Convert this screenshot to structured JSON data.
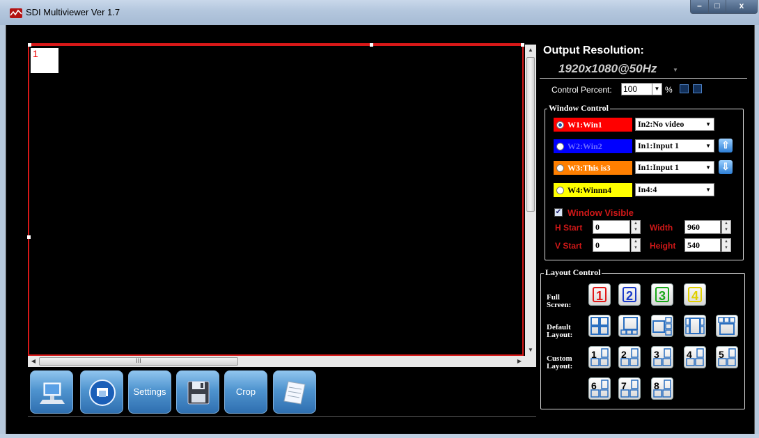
{
  "window": {
    "title": "SDI Multiviewer  Ver 1.7",
    "controls": {
      "minimize": "–",
      "maximize": "□",
      "close": "x"
    }
  },
  "preview": {
    "window_label": "1",
    "hscroll_grip": "III"
  },
  "toolbar": {
    "settings_label": "Settings",
    "crop_label": "Crop"
  },
  "output": {
    "title": "Output Resolution:",
    "resolution": "1920x1080@50Hz"
  },
  "control_percent": {
    "label": "Control Percent:",
    "value": "100",
    "unit": "%"
  },
  "window_control": {
    "legend": "Window Control",
    "windows": [
      {
        "name": "W1:Win1",
        "input": "In2:No video",
        "color": "#ff0000",
        "text_color": "#ffffff",
        "selected": true
      },
      {
        "name": "W2:Win2",
        "input": "In1:Input 1",
        "color": "#0000ff",
        "text_color": "#6a6aff",
        "selected": false
      },
      {
        "name": "W3:This is3",
        "input": "In1:Input 1",
        "color": "#ff7f00",
        "text_color": "#ffffff",
        "selected": false
      },
      {
        "name": "W4:Winnn4",
        "input": "In4:4",
        "color": "#ffff00",
        "text_color": "#000000",
        "selected": false
      }
    ],
    "visible_label": "Window Visible",
    "visible_checked": true,
    "h_start_label": "H Start",
    "h_start": "0",
    "v_start_label": "V Start",
    "v_start": "0",
    "width_label": "Width",
    "width": "960",
    "height_label": "Height",
    "height": "540"
  },
  "layout_control": {
    "legend": "Layout Control",
    "full_screen_label": "Full Screen:",
    "default_layout_label": "Default Layout:",
    "custom_layout_label": "Custom Layout:",
    "full_screen": [
      {
        "num": "1",
        "color": "#e01818"
      },
      {
        "num": "2",
        "color": "#1838c8"
      },
      {
        "num": "3",
        "color": "#18a818"
      },
      {
        "num": "4",
        "color": "#e0d000"
      }
    ],
    "custom": [
      "1",
      "2",
      "3",
      "4",
      "5",
      "6",
      "7",
      "8"
    ]
  }
}
